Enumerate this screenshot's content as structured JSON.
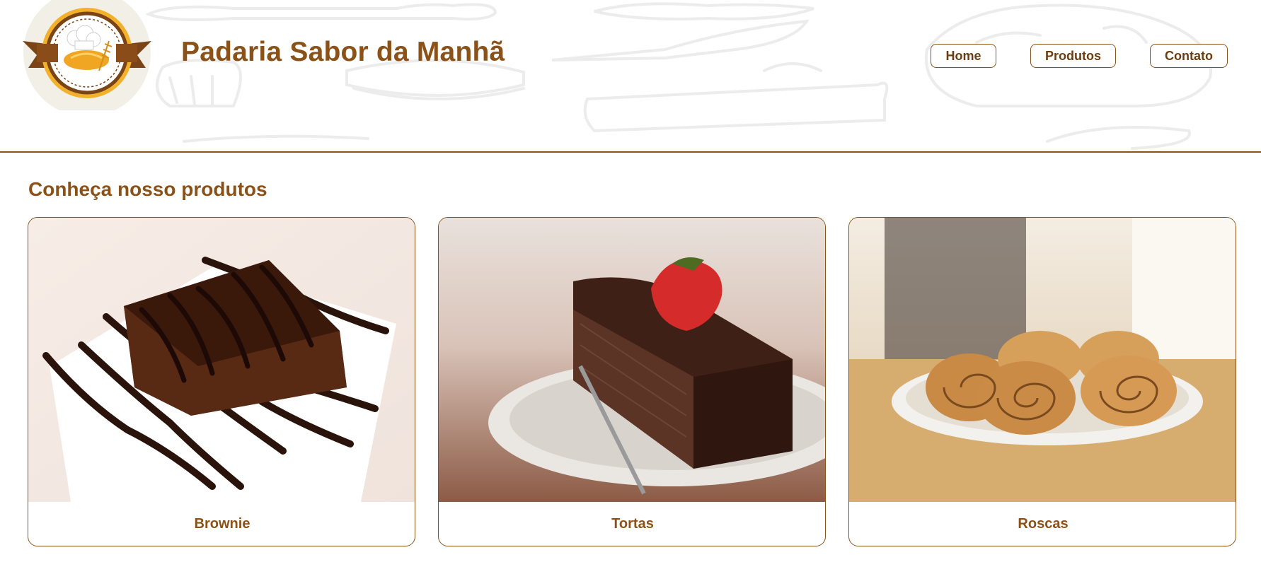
{
  "header": {
    "site_title": "Padaria Sabor da Manhã",
    "logo_icon": "bakery-logo-icon",
    "nav": [
      {
        "label": "Home"
      },
      {
        "label": "Produtos"
      },
      {
        "label": "Contato"
      }
    ]
  },
  "main": {
    "section_title": "Conheça nosso produtos",
    "products": [
      {
        "name": "Brownie",
        "image": "brownie-photo"
      },
      {
        "name": "Tortas",
        "image": "chocolate-cake-slice-photo"
      },
      {
        "name": "Roscas",
        "image": "cinnamon-rolls-photo"
      }
    ]
  },
  "colors": {
    "brand": "#8a5218",
    "background": "#ffffff",
    "logo_gold": "#f3b02b"
  }
}
